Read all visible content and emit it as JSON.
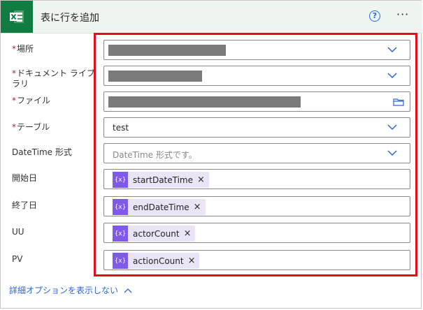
{
  "header": {
    "title": "表に行を追加",
    "help_icon": "?",
    "more_icon": "···"
  },
  "fields": {
    "location": {
      "label": "場所",
      "required": "*"
    },
    "library": {
      "label_line1": "ドキュメント ライブ",
      "label_line2": "ラリ",
      "required": "*"
    },
    "file": {
      "label": "ファイル",
      "required": "*"
    },
    "table": {
      "label": "テーブル",
      "required": "*",
      "value": "test"
    },
    "datetime": {
      "label": "DateTime 形式",
      "placeholder": "DateTime 形式です。"
    },
    "start_date": {
      "label": "開始日",
      "token": "startDateTime"
    },
    "end_date": {
      "label": "終了日",
      "token": "endDateTime"
    },
    "uu": {
      "label": "UU",
      "token": "actorCount"
    },
    "pv": {
      "label": "PV",
      "token": "actionCount"
    }
  },
  "token_icon": "{x}",
  "token_remove": "×",
  "advanced_options": "詳細オプションを表示しない",
  "colors": {
    "excel_green": "#107c41",
    "token_purple": "#7f5ae8",
    "highlight_red": "#e00d1e",
    "link_blue": "#2b66d9"
  }
}
